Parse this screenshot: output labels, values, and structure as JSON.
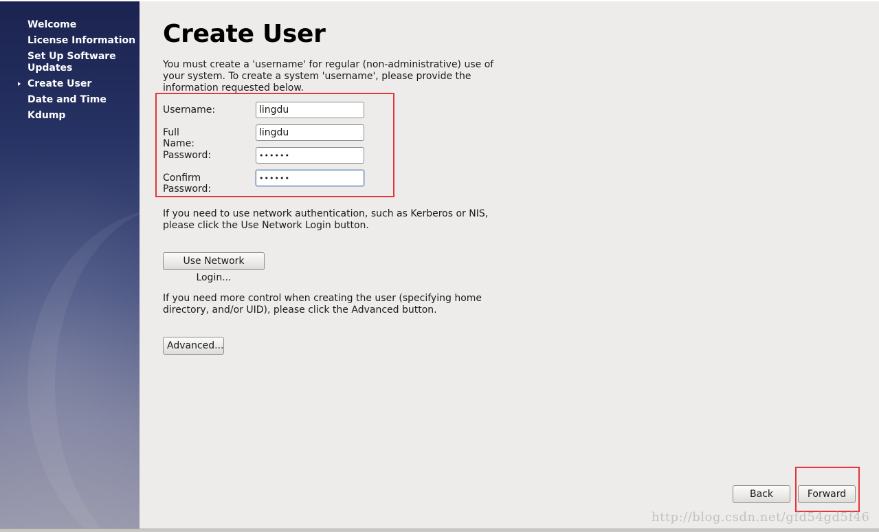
{
  "sidebar": {
    "items": [
      {
        "label": "Welcome",
        "current": false
      },
      {
        "label": "License Information",
        "current": false
      },
      {
        "label": "Set Up Software Updates",
        "current": false
      },
      {
        "label": "Create User",
        "current": true
      },
      {
        "label": "Date and Time",
        "current": false
      },
      {
        "label": "Kdump",
        "current": false
      }
    ]
  },
  "main": {
    "title": "Create User",
    "intro": "You must create a 'username' for regular (non-administrative) use of your system.  To create a system 'username', please provide the information requested below.",
    "form": {
      "username_label": "Username:",
      "username_value": "lingdu",
      "fullname_label": "Full Name:",
      "fullname_value": "lingdu",
      "password_label": "Password:",
      "password_value": "••••••",
      "confirm_label": "Confirm Password:",
      "confirm_value": "••••••"
    },
    "network_text": "If you need to use network authentication, such as Kerberos or NIS, please click the Use Network Login button.",
    "network_button": "Use Network Login...",
    "advanced_text": "If you need more control when creating the user (specifying home directory, and/or UID), please click the Advanced button.",
    "advanced_button": "Advanced..."
  },
  "footer": {
    "back_label": "Back",
    "forward_label": "Forward"
  },
  "watermark": "http://blog.csdn.net/gfd54gd5f46",
  "colors": {
    "highlight": "#e5343a",
    "sidebar_top": "#1b2350",
    "background": "#edeceb"
  }
}
